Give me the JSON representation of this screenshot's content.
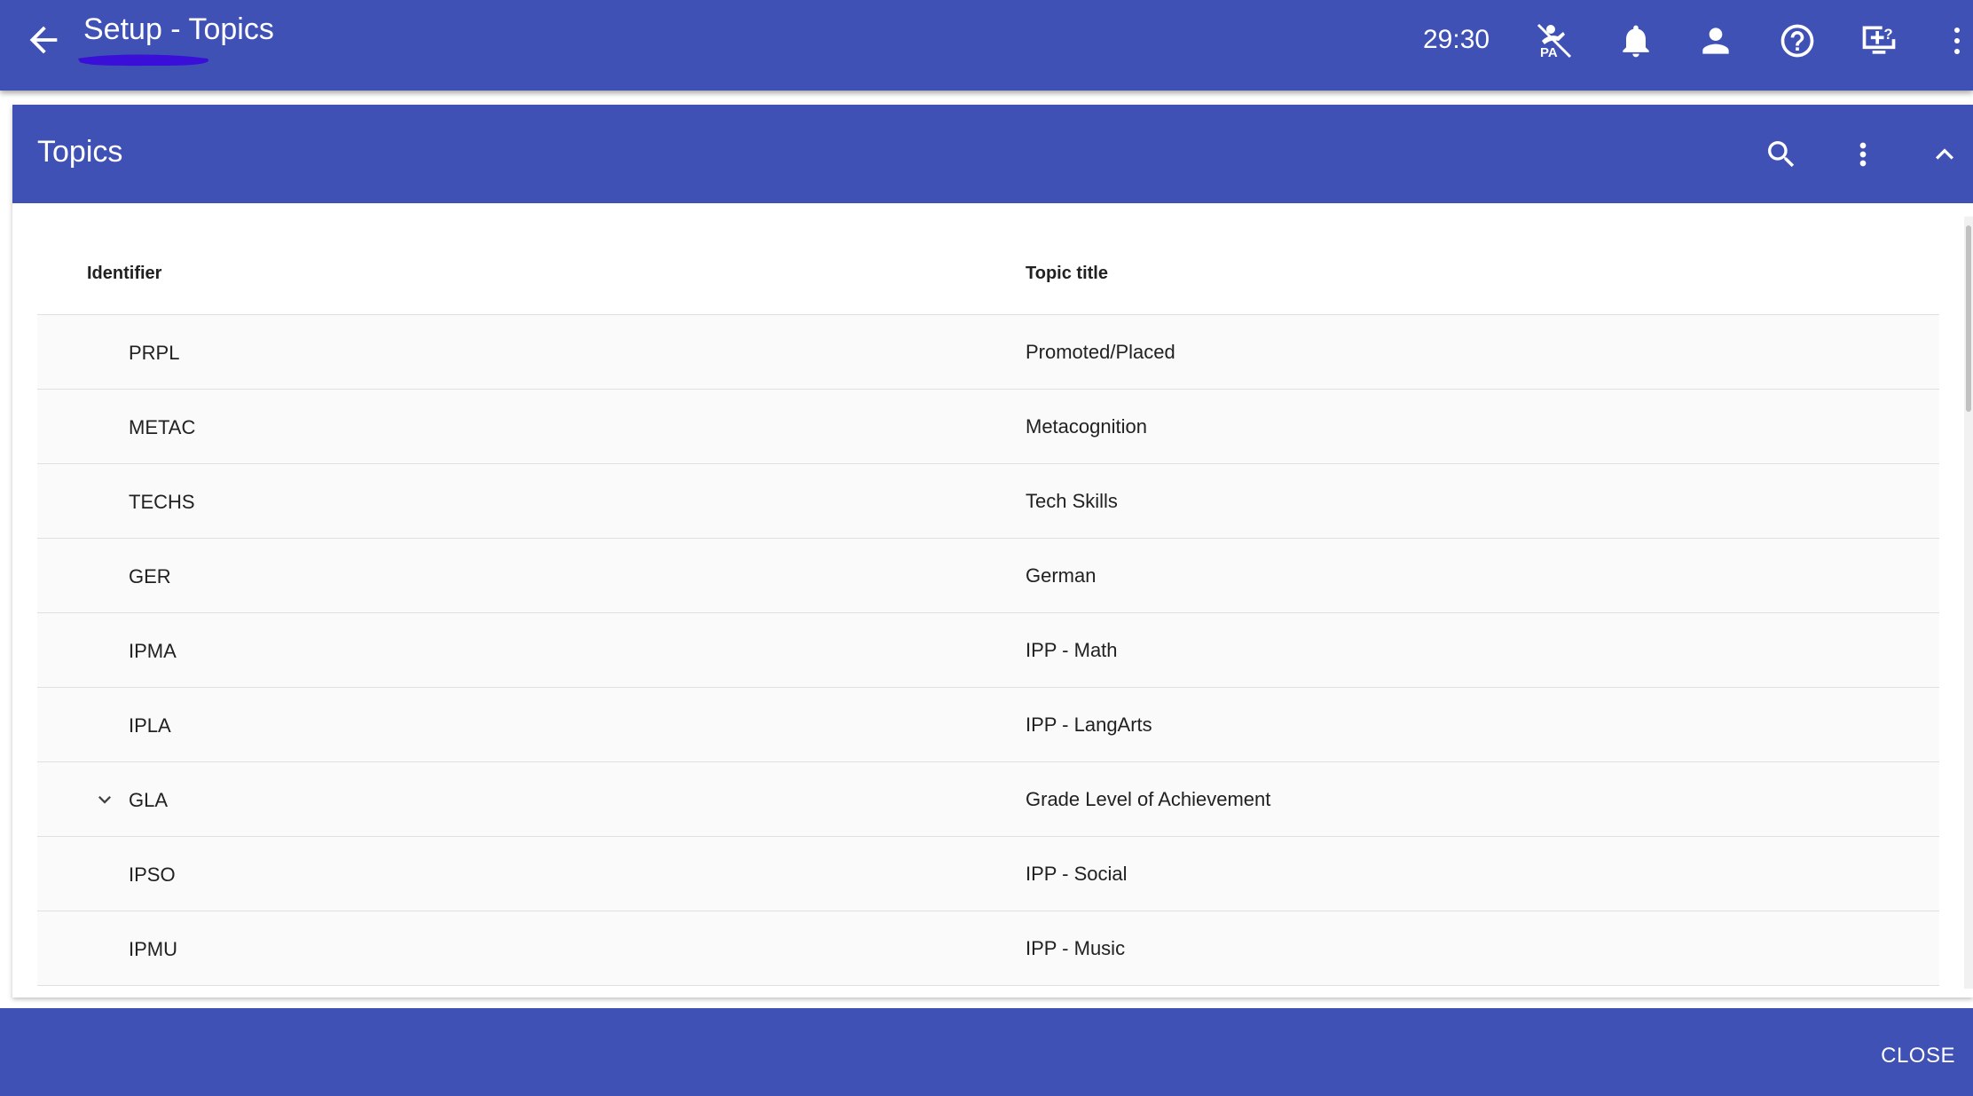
{
  "app_bar": {
    "title": "Setup - Topics",
    "timer": "29:30",
    "icons": [
      "back-arrow-icon",
      "pa-icon",
      "bell-icon",
      "person-icon",
      "help-icon",
      "screen-help-icon",
      "more-vert-icon"
    ]
  },
  "panel": {
    "title": "Topics",
    "icons": [
      "search-icon",
      "more-vert-icon",
      "chevron-up-icon"
    ]
  },
  "table": {
    "headers": {
      "identifier": "Identifier",
      "topic_title": "Topic title"
    },
    "rows": [
      {
        "identifier": "PRPL",
        "title": "Promoted/Placed",
        "expandable": false
      },
      {
        "identifier": "METAC",
        "title": "Metacognition",
        "expandable": false
      },
      {
        "identifier": "TECHS",
        "title": "Tech Skills",
        "expandable": false
      },
      {
        "identifier": "GER",
        "title": "German",
        "expandable": false
      },
      {
        "identifier": "IPMA",
        "title": "IPP - Math",
        "expandable": false
      },
      {
        "identifier": "IPLA",
        "title": "IPP - LangArts",
        "expandable": false
      },
      {
        "identifier": "GLA",
        "title": "Grade Level of Achievement",
        "expandable": true
      },
      {
        "identifier": "IPSO",
        "title": "IPP - Social",
        "expandable": false
      },
      {
        "identifier": "IPMU",
        "title": "IPP - Music",
        "expandable": false
      }
    ]
  },
  "footer": {
    "close_label": "CLOSE"
  },
  "colors": {
    "primary": "#3f51b5",
    "row_background": "#fafafa",
    "divider": "#e0e0e0",
    "highlight_scribble": "#3a10d8"
  }
}
